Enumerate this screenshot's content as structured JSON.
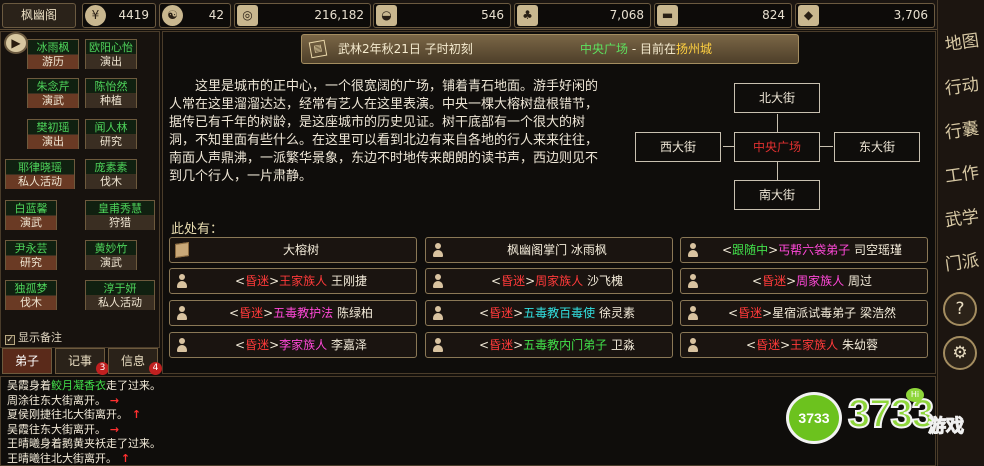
{
  "topbar": {
    "sect_name": "枫幽阁",
    "resources": [
      {
        "icon": "coin-icon",
        "glyph": "¥",
        "value": "4419"
      },
      {
        "icon": "yinyang-icon",
        "glyph": "☯",
        "value": "42"
      },
      {
        "icon": "copper-coin-icon",
        "glyph": "◎",
        "value": "216,182"
      },
      {
        "icon": "rice-bowl-icon",
        "glyph": "◒",
        "value": "546"
      },
      {
        "icon": "herb-icon",
        "glyph": "♣",
        "value": "7,068"
      },
      {
        "icon": "wood-icon",
        "glyph": "▬",
        "value": "824"
      },
      {
        "icon": "ore-icon",
        "glyph": "◆",
        "value": "3,706"
      }
    ]
  },
  "roster": {
    "play_glyph": "▶",
    "members": [
      {
        "name": "冰雨枫",
        "action": "游历"
      },
      {
        "name": "欧阳心怡",
        "action": "演出"
      },
      {
        "name": "朱念芹",
        "action": "演武"
      },
      {
        "name": "陈怡然",
        "action": "种植"
      },
      {
        "name": "樊初瑶",
        "action": "演出"
      },
      {
        "name": "闻人林",
        "action": "研究"
      },
      {
        "name": "耶律晓瑶",
        "action": "私人活动"
      },
      {
        "name": "庞素素",
        "action": "伐木"
      },
      {
        "name": "白蓝馨",
        "action": "演武"
      },
      {
        "name": "皇甫秀慧",
        "action": "狩猎"
      },
      {
        "name": "尹永芸",
        "action": "研究"
      },
      {
        "name": "黄妙竹",
        "action": "演武"
      },
      {
        "name": "独孤梦",
        "action": "伐木"
      },
      {
        "name": "淳于妍",
        "action": "私人活动"
      }
    ],
    "show_memo": "显示备注",
    "memo_checked": "✓"
  },
  "tabs": [
    {
      "label": "弟子",
      "badge": ""
    },
    {
      "label": "记事",
      "badge": "3"
    },
    {
      "label": "信息",
      "badge": "4"
    }
  ],
  "main": {
    "calendar_glyph": "▤",
    "date": "武林2年秋21日 子时初刻",
    "location": {
      "place": "中央广场",
      "sep": " - 目前在",
      "city": "扬州城"
    },
    "description": "这里是城市的正中心，一个很宽阔的广场，铺着青石地面。游手好闲的人常在这里溜溜达达，经常有艺人在这里表演。中央一棵大榕树盘根错节，据传已有千年的树龄，是这座城市的历史见证。树干底部有一个很大的树洞，不知里面有些什么。在这里可以看到北边有来自各地的行人来来往往，南面人声鼎沸，一派繁华景象，东边不时地传来朗朗的读书声，西边则见不到几个行人，一片肃静。",
    "map": {
      "north": "北大街",
      "west": "西大街",
      "center": "中央广场",
      "east": "东大街",
      "south": "南大街"
    },
    "here_label": "此处有：",
    "entities": [
      {
        "icon": "box",
        "parts": [
          {
            "t": "大榕树",
            "c": ""
          }
        ]
      },
      {
        "icon": "person",
        "parts": [
          {
            "t": "枫幽阁掌门 冰雨枫",
            "c": ""
          }
        ]
      },
      {
        "icon": "person",
        "parts": [
          {
            "t": "<",
            "c": ""
          },
          {
            "t": "跟随中",
            "c": "grn"
          },
          {
            "t": ">",
            "c": ""
          },
          {
            "t": "丐帮六袋弟子",
            "c": "mag"
          },
          {
            "t": " 司空瑶瑾",
            "c": ""
          }
        ]
      },
      {
        "icon": "person",
        "parts": [
          {
            "t": "<",
            "c": ""
          },
          {
            "t": "昏迷",
            "c": "red"
          },
          {
            "t": ">",
            "c": ""
          },
          {
            "t": "王家族人",
            "c": "red"
          },
          {
            "t": " 王刚捷",
            "c": ""
          }
        ]
      },
      {
        "icon": "person",
        "parts": [
          {
            "t": "<",
            "c": ""
          },
          {
            "t": "昏迷",
            "c": "red"
          },
          {
            "t": ">",
            "c": ""
          },
          {
            "t": "周家族人",
            "c": "red"
          },
          {
            "t": " 沙飞槐",
            "c": ""
          }
        ]
      },
      {
        "icon": "person",
        "parts": [
          {
            "t": "<",
            "c": ""
          },
          {
            "t": "昏迷",
            "c": "red"
          },
          {
            "t": ">",
            "c": ""
          },
          {
            "t": "周家族人",
            "c": "mag"
          },
          {
            "t": " 周过",
            "c": ""
          }
        ]
      },
      {
        "icon": "person",
        "parts": [
          {
            "t": "<",
            "c": ""
          },
          {
            "t": "昏迷",
            "c": "red"
          },
          {
            "t": ">",
            "c": ""
          },
          {
            "t": "五毒教护法",
            "c": "mag"
          },
          {
            "t": " 陈绿柏",
            "c": ""
          }
        ]
      },
      {
        "icon": "person",
        "parts": [
          {
            "t": "<",
            "c": ""
          },
          {
            "t": "昏迷",
            "c": "red"
          },
          {
            "t": ">",
            "c": ""
          },
          {
            "t": "五毒教百毒使",
            "c": "cyn"
          },
          {
            "t": " 徐灵素",
            "c": ""
          }
        ]
      },
      {
        "icon": "person",
        "parts": [
          {
            "t": "<",
            "c": ""
          },
          {
            "t": "昏迷",
            "c": "red"
          },
          {
            "t": ">",
            "c": ""
          },
          {
            "t": "星宿派试毒弟子 梁浩然",
            "c": ""
          }
        ]
      },
      {
        "icon": "person",
        "parts": [
          {
            "t": "<",
            "c": ""
          },
          {
            "t": "昏迷",
            "c": "red"
          },
          {
            "t": ">",
            "c": ""
          },
          {
            "t": "李家族人",
            "c": "mag"
          },
          {
            "t": " 李嘉泽",
            "c": ""
          }
        ]
      },
      {
        "icon": "person",
        "parts": [
          {
            "t": "<",
            "c": ""
          },
          {
            "t": "昏迷",
            "c": "red"
          },
          {
            "t": ">",
            "c": ""
          },
          {
            "t": "五毒教内门弟子",
            "c": "grn"
          },
          {
            "t": " 卫淼",
            "c": ""
          }
        ]
      },
      {
        "icon": "person",
        "parts": [
          {
            "t": "<",
            "c": ""
          },
          {
            "t": "昏迷",
            "c": "red"
          },
          {
            "t": ">",
            "c": ""
          },
          {
            "t": "王家族人",
            "c": "red"
          },
          {
            "t": " 朱幼蓉",
            "c": ""
          }
        ]
      }
    ]
  },
  "right_menu": {
    "items": [
      "地图",
      "行动",
      "行囊",
      "工作",
      "武学",
      "门派"
    ],
    "help": "?",
    "settings": "⚙"
  },
  "log": [
    [
      {
        "t": "吴霞身着",
        "c": ""
      },
      {
        "t": "鲛月凝香衣",
        "c": "grn"
      },
      {
        "t": "走了过来。",
        "c": ""
      }
    ],
    [
      {
        "t": "周涂往东大街离开。",
        "c": ""
      },
      {
        "t": " →",
        "c": "arr"
      }
    ],
    [
      {
        "t": "夏侯刚捷往北大街离开。",
        "c": ""
      },
      {
        "t": " ↑",
        "c": "arr"
      }
    ],
    [
      {
        "t": "吴霞往东大街离开。",
        "c": ""
      },
      {
        "t": " →",
        "c": "arr"
      }
    ],
    [
      {
        "t": "王晴曦身着鹅黄夹袄走了过来。",
        "c": ""
      }
    ],
    [
      {
        "t": "王晴曦往北大街离开。",
        "c": ""
      },
      {
        "t": " ↑",
        "c": "arr"
      }
    ]
  ],
  "watermark": {
    "circle": "3733",
    "big": "3733",
    "game": "游戏",
    "hi": "Hi"
  }
}
